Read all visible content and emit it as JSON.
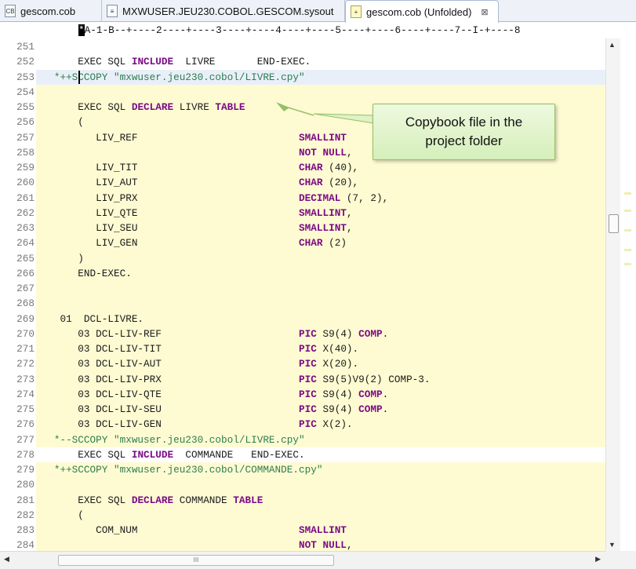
{
  "tabs": [
    {
      "icon": "cobol-file-icon",
      "badge": "CB",
      "label": "gescom.cob",
      "close": ""
    },
    {
      "icon": "text-file-icon",
      "badge": "",
      "label": "MXWUSER.JEU230.COBOL.GESCOM.sysout",
      "close": ""
    },
    {
      "icon": "unfolded-file-icon",
      "badge": "",
      "label": "gescom.cob (Unfolded)",
      "close": "⊠"
    }
  ],
  "ruler": "A-1-B--+----2----+----3----+----4----+----5----+----6----+----7--I-+----8",
  "ruler_cursor": "*",
  "lines": [
    {
      "n": "251",
      "t": ""
    },
    {
      "n": "252",
      "t": "       EXEC SQL INCLUDE  LIVRE       END-EXEC."
    },
    {
      "n": "253",
      "t": "   *++SCCOPY \"mxwuser.jeu230.cobol/LIVRE.cpy\""
    },
    {
      "n": "254",
      "t": ""
    },
    {
      "n": "255",
      "t": "       EXEC SQL DECLARE LIVRE TABLE"
    },
    {
      "n": "256",
      "t": "       ("
    },
    {
      "n": "257",
      "t": "          LIV_REF                           SMALLINT"
    },
    {
      "n": "258",
      "t": "                                            NOT NULL,"
    },
    {
      "n": "259",
      "t": "          LIV_TIT                           CHAR (40),"
    },
    {
      "n": "260",
      "t": "          LIV_AUT                           CHAR (20),"
    },
    {
      "n": "261",
      "t": "          LIV_PRX                           DECIMAL (7, 2),"
    },
    {
      "n": "262",
      "t": "          LIV_QTE                           SMALLINT,"
    },
    {
      "n": "263",
      "t": "          LIV_SEU                           SMALLINT,"
    },
    {
      "n": "264",
      "t": "          LIV_GEN                           CHAR (2)"
    },
    {
      "n": "265",
      "t": "       )"
    },
    {
      "n": "266",
      "t": "       END-EXEC."
    },
    {
      "n": "267",
      "t": ""
    },
    {
      "n": "268",
      "t": ""
    },
    {
      "n": "269",
      "t": "    01  DCL-LIVRE."
    },
    {
      "n": "270",
      "t": "       03 DCL-LIV-REF                       PIC S9(4) COMP."
    },
    {
      "n": "271",
      "t": "       03 DCL-LIV-TIT                       PIC X(40)."
    },
    {
      "n": "272",
      "t": "       03 DCL-LIV-AUT                       PIC X(20)."
    },
    {
      "n": "273",
      "t": "       03 DCL-LIV-PRX                       PIC S9(5)V9(2) COMP-3."
    },
    {
      "n": "274",
      "t": "       03 DCL-LIV-QTE                       PIC S9(4) COMP."
    },
    {
      "n": "275",
      "t": "       03 DCL-LIV-SEU                       PIC S9(4) COMP."
    },
    {
      "n": "276",
      "t": "       03 DCL-LIV-GEN                       PIC X(2)."
    },
    {
      "n": "277",
      "t": "   *--SCCOPY \"mxwuser.jeu230.cobol/LIVRE.cpy\""
    },
    {
      "n": "278",
      "t": "       EXEC SQL INCLUDE  COMMANDE   END-EXEC."
    },
    {
      "n": "279",
      "t": "   *++SCCOPY \"mxwuser.jeu230.cobol/COMMANDE.cpy\""
    },
    {
      "n": "280",
      "t": ""
    },
    {
      "n": "281",
      "t": "       EXEC SQL DECLARE COMMANDE TABLE"
    },
    {
      "n": "282",
      "t": "       ("
    },
    {
      "n": "283",
      "t": "          COM_NUM                           SMALLINT"
    },
    {
      "n": "284",
      "t": "                                            NOT NULL,"
    }
  ],
  "callout": {
    "text": "Copybook file in the project folder"
  },
  "scrollbar": {
    "up": "▲",
    "down": "▼",
    "left": "◀",
    "right": "▶",
    "grip": "III"
  },
  "colors": {
    "copy_highlight": "#fefbd2",
    "current_line": "#e9eff8",
    "keyword": "#7b0b86",
    "comment": "#2e7d50",
    "callout_border": "#96bf69"
  }
}
